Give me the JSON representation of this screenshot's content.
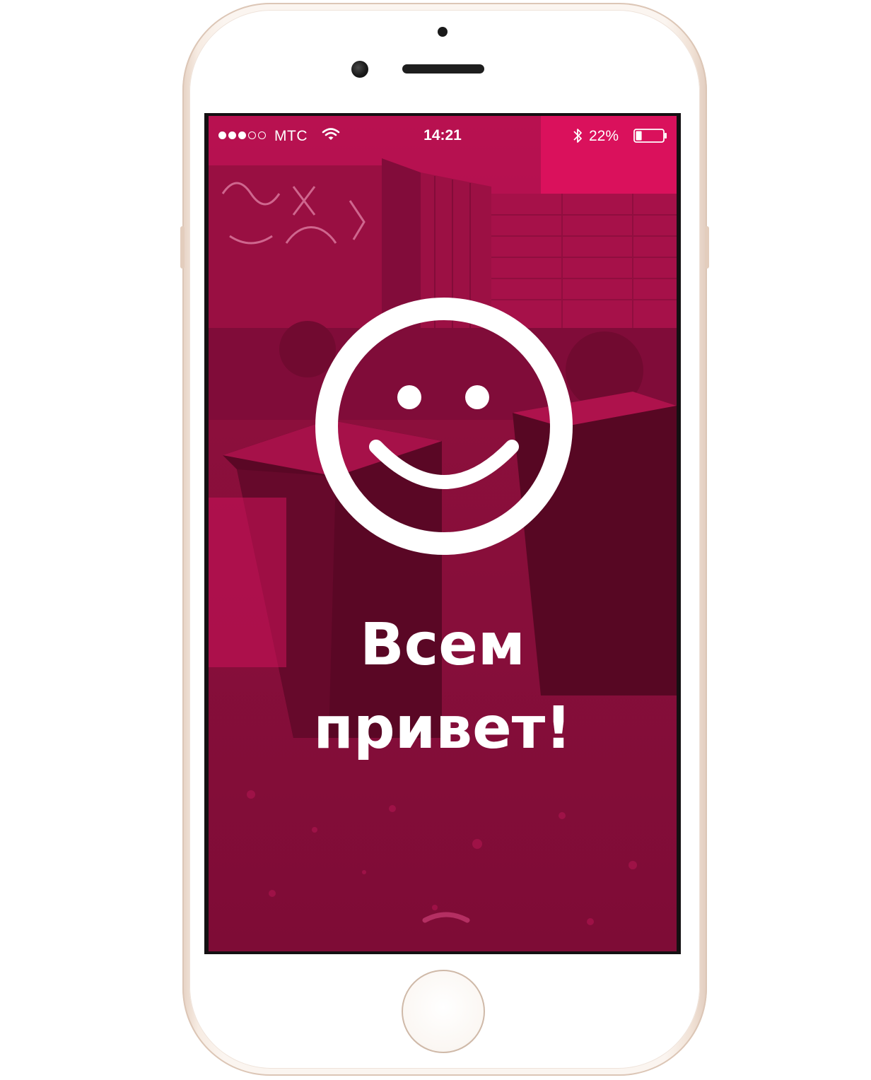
{
  "status_bar": {
    "signal_bars": [
      true,
      true,
      true,
      false,
      false
    ],
    "carrier": "МТС",
    "time": "14:21",
    "battery_percent_text": "22%",
    "battery_level": 0.22,
    "icons": [
      "wifi-icon",
      "bluetooth-icon",
      "battery-icon"
    ]
  },
  "screen": {
    "logo_icon": "smiley-face-icon",
    "greeting_line_1": "Всем",
    "greeting_line_2": "привет!",
    "pull_handle_icon": "chevron-up-icon"
  },
  "colors": {
    "overlay_tint": "#e0135f",
    "text": "#ffffff",
    "phone_body": "#fbf5f0",
    "phone_edge": "#e3cdbd"
  }
}
